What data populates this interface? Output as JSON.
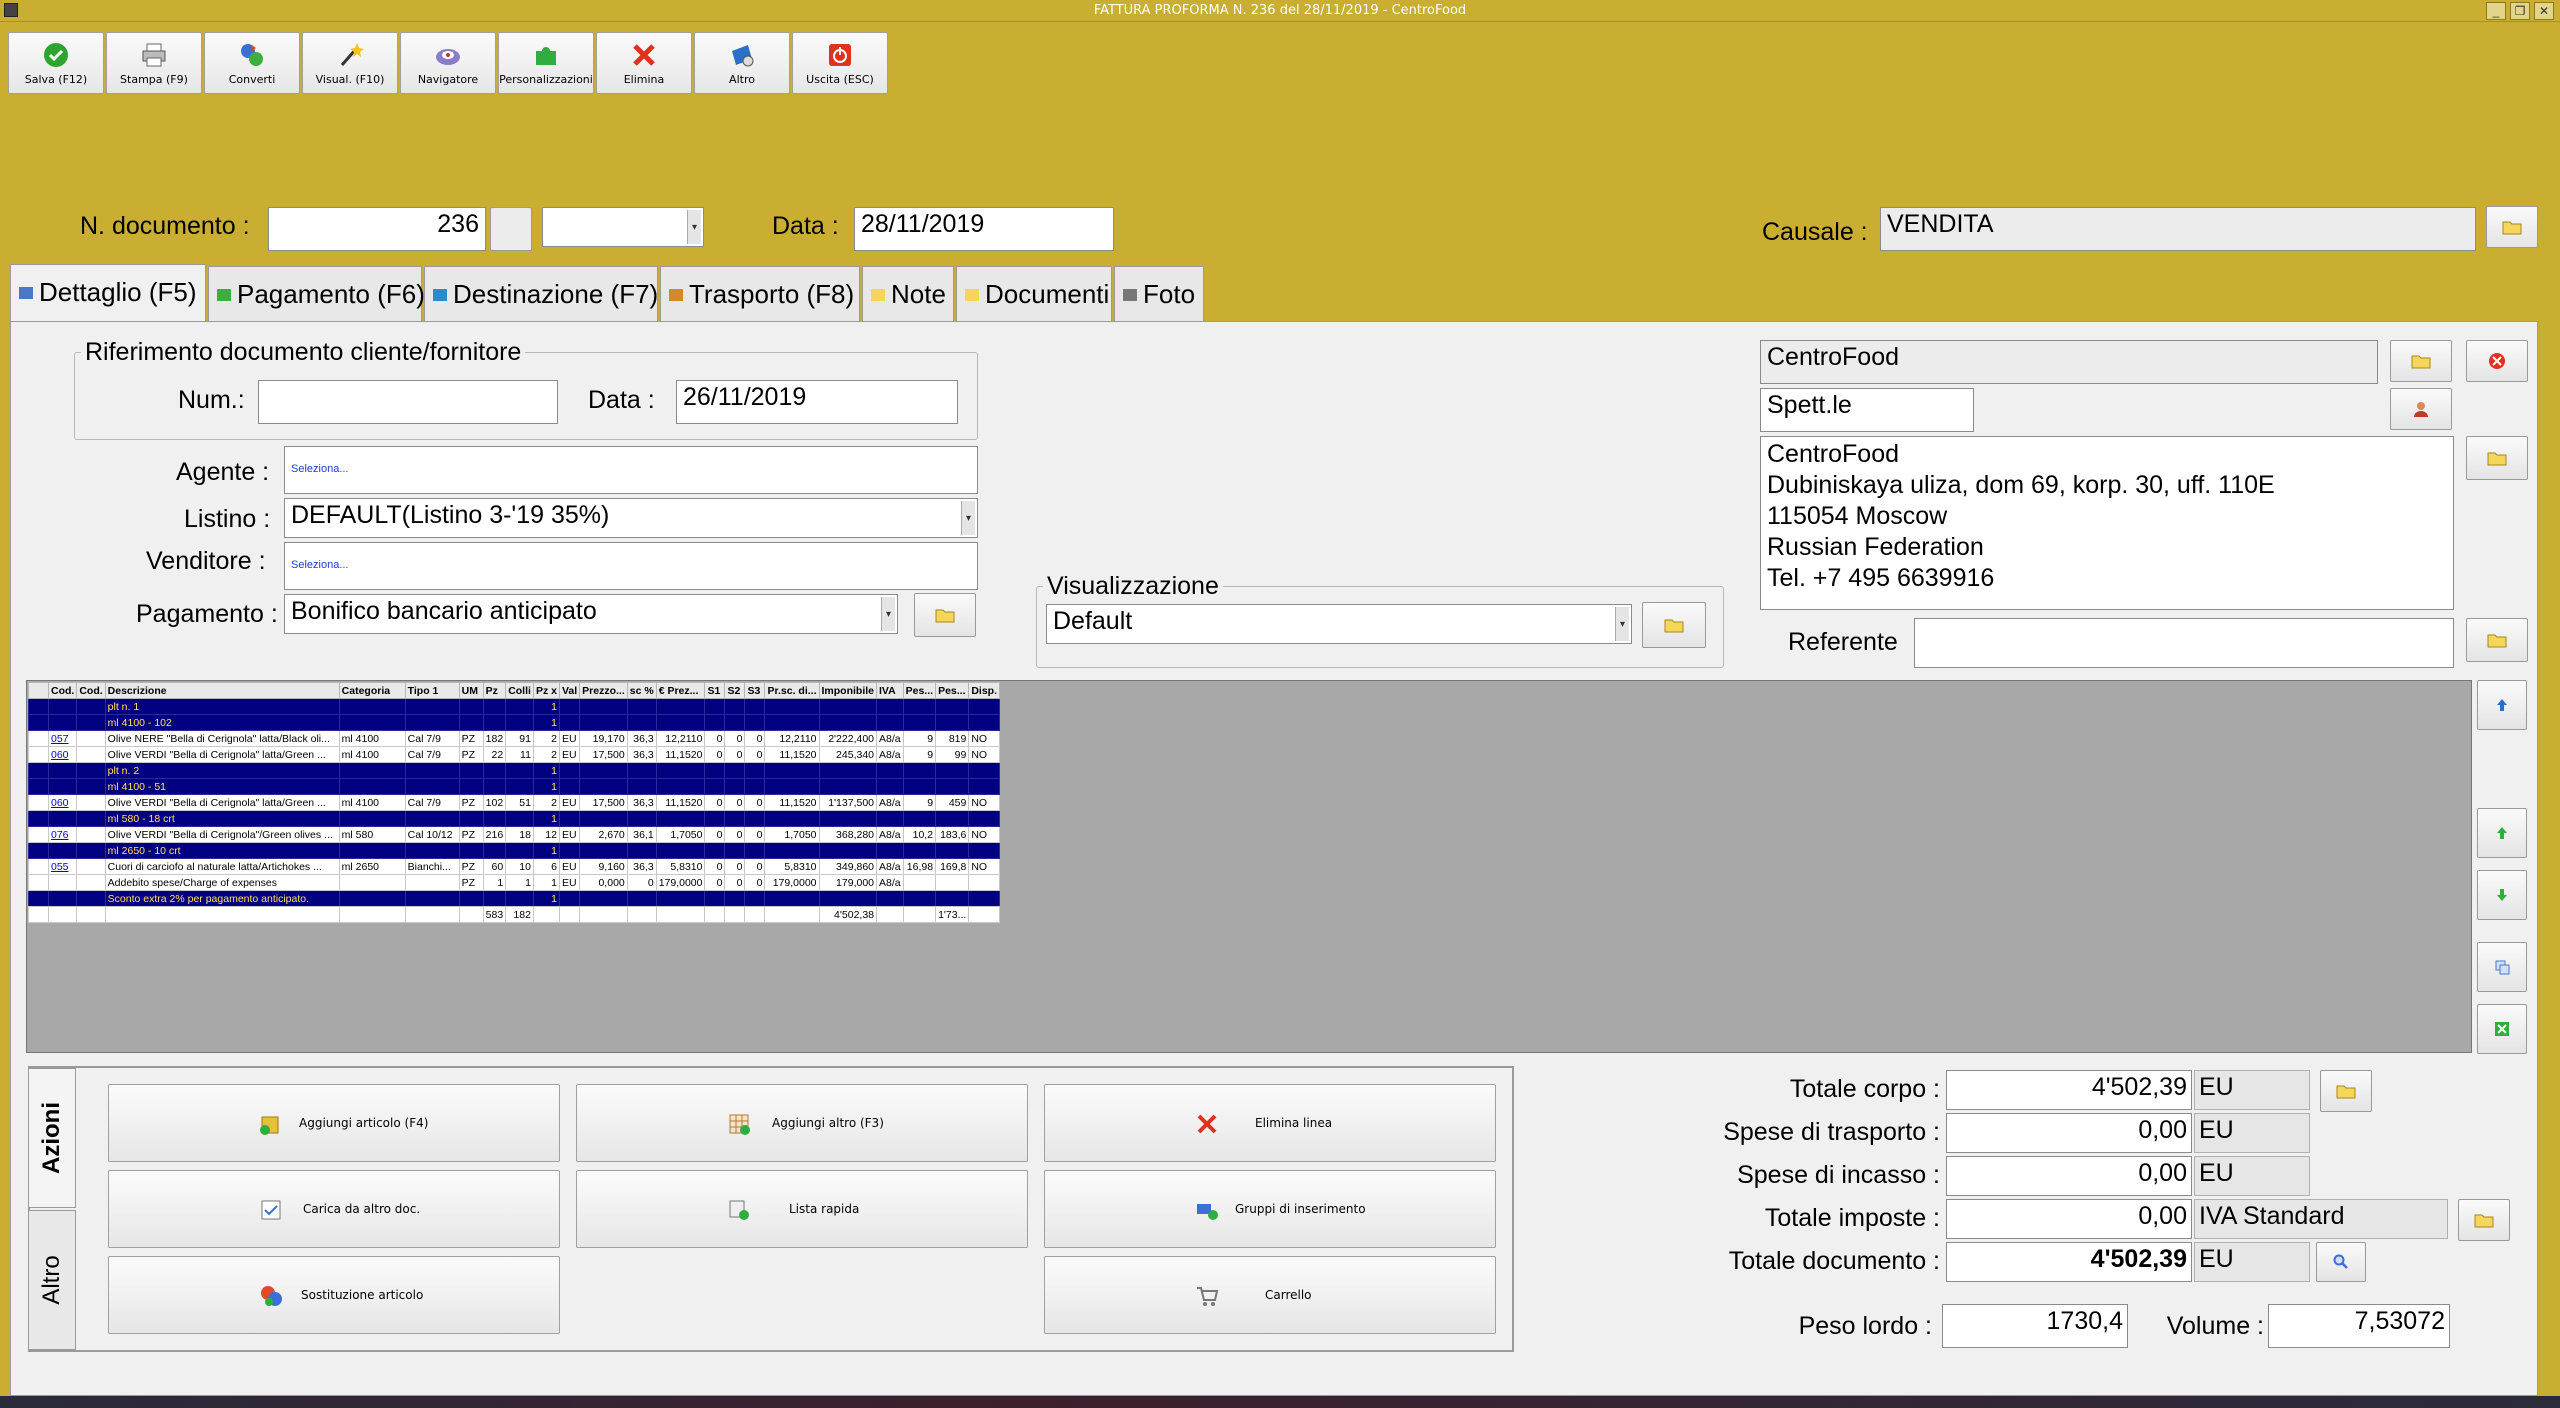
{
  "window": {
    "title": "FATTURA PROFORMA N. 236 del 28/11/2019 - CentroFood"
  },
  "toolbar": [
    {
      "label": "Salva (F12)",
      "icon": "check-icon"
    },
    {
      "label": "Stampa (F9)",
      "icon": "printer-icon"
    },
    {
      "label": "Converti",
      "icon": "convert-icon"
    },
    {
      "label": "Visual. (F10)",
      "icon": "magic-wand-icon"
    },
    {
      "label": "Navigatore",
      "icon": "navigator-icon"
    },
    {
      "label": "Personalizzazioni",
      "icon": "puzzle-icon"
    },
    {
      "label": "Elimina",
      "icon": "delete-x-icon"
    },
    {
      "label": "Altro",
      "icon": "more-icon"
    },
    {
      "label": "Uscita (ESC)",
      "icon": "exit-icon"
    }
  ],
  "header": {
    "doc_number_label": "N. documento :",
    "doc_number": "236",
    "date_label": "Data :",
    "date": "28/11/2019",
    "causale_label": "Causale :",
    "causale": "VENDITA"
  },
  "tabs": [
    {
      "label": "Dettaglio (F5)"
    },
    {
      "label": "Pagamento (F6)"
    },
    {
      "label": "Destinazione (F7)"
    },
    {
      "label": "Trasporto (F8)"
    },
    {
      "label": "Note"
    },
    {
      "label": "Documenti"
    },
    {
      "label": "Foto"
    }
  ],
  "ref_group": {
    "legend": "Riferimento documento cliente/fornitore",
    "num_label": "Num.:",
    "num": "",
    "date_label": "Data :",
    "date": "26/11/2019"
  },
  "form": {
    "agente_label": "Agente :",
    "agente": "Seleziona...",
    "listino_label": "Listino :",
    "listino": "DEFAULT(Listino 3-'19 35%)",
    "venditore_label": "Venditore :",
    "venditore": "Seleziona...",
    "pagamento_label": "Pagamento :",
    "pagamento": "Bonifico bancario anticipato",
    "visualizzazione_legend": "Visualizzazione",
    "visualizzazione": "Default"
  },
  "customer": {
    "name": "CentroFood",
    "salutation": "Spett.le",
    "address_lines": [
      "CentroFood",
      "Dubiniskaya uliza, dom 69, korp. 30, uff. 110E",
      "115054 Moscow",
      "Russian Federation",
      "Tel. +7 495 6639916"
    ],
    "referente_label": "Referente",
    "referente": ""
  },
  "grid": {
    "columns": [
      "",
      "Cod.",
      "Cod.",
      "Descrizione",
      "Categoria",
      "Tipo 1",
      "UM",
      "Pz",
      "Colli",
      "Pz x",
      "Val",
      "Prezzo...",
      "sc %",
      "€ Prez...",
      "S1",
      "S2",
      "S3",
      "Pr.sc. di...",
      "Imponibile",
      "IVA",
      "Pes...",
      "Pes...",
      "Disp."
    ],
    "rows": [
      {
        "type": "sep",
        "cells": [
          "",
          "",
          "",
          "plt n. 1",
          "",
          "",
          "",
          "",
          "",
          "1",
          "",
          "",
          "",
          "",
          "",
          "",
          "",
          "",
          "",
          "",
          "",
          "",
          ""
        ]
      },
      {
        "type": "sep",
        "cells": [
          "",
          "",
          "",
          "ml 4100 - 102",
          "",
          "",
          "",
          "",
          "",
          "1",
          "",
          "",
          "",
          "",
          "",
          "",
          "",
          "",
          "",
          "",
          "",
          "",
          ""
        ]
      },
      {
        "type": "item",
        "cells": [
          "",
          "057",
          "",
          "Olive NERE \"Bella di Cerignola\" latta/Black oli...",
          "ml 4100",
          "Cal 7/9",
          "PZ",
          "182",
          "91",
          "2",
          "EU",
          "19,170",
          "36,3",
          "12,2110",
          "0",
          "0",
          "0",
          "12,2110",
          "2'222,400",
          "A8/a",
          "9",
          "819",
          "NO"
        ]
      },
      {
        "type": "item",
        "cells": [
          "",
          "060",
          "",
          "Olive VERDI \"Bella di Cerignola\" latta/Green ...",
          "ml 4100",
          "Cal 7/9",
          "PZ",
          "22",
          "11",
          "2",
          "EU",
          "17,500",
          "36,3",
          "11,1520",
          "0",
          "0",
          "0",
          "11,1520",
          "245,340",
          "A8/a",
          "9",
          "99",
          "NO"
        ]
      },
      {
        "type": "sep",
        "cells": [
          "",
          "",
          "",
          "plt n. 2",
          "",
          "",
          "",
          "",
          "",
          "1",
          "",
          "",
          "",
          "",
          "",
          "",
          "",
          "",
          "",
          "",
          "",
          "",
          ""
        ]
      },
      {
        "type": "sep",
        "cells": [
          "",
          "",
          "",
          "ml 4100 - 51",
          "",
          "",
          "",
          "",
          "",
          "1",
          "",
          "",
          "",
          "",
          "",
          "",
          "",
          "",
          "",
          "",
          "",
          "",
          ""
        ]
      },
      {
        "type": "item",
        "cells": [
          "",
          "060",
          "",
          "Olive VERDI \"Bella di Cerignola\" latta/Green ...",
          "ml 4100",
          "Cal 7/9",
          "PZ",
          "102",
          "51",
          "2",
          "EU",
          "17,500",
          "36,3",
          "11,1520",
          "0",
          "0",
          "0",
          "11,1520",
          "1'137,500",
          "A8/a",
          "9",
          "459",
          "NO"
        ]
      },
      {
        "type": "sep",
        "cells": [
          "",
          "",
          "",
          "ml 580 - 18 crt",
          "",
          "",
          "",
          "",
          "",
          "1",
          "",
          "",
          "",
          "",
          "",
          "",
          "",
          "",
          "",
          "",
          "",
          "",
          ""
        ]
      },
      {
        "type": "item",
        "cells": [
          "",
          "076",
          "",
          "Olive VERDI \"Bella di Cerignola\"/Green olives ...",
          "ml 580",
          "Cal 10/12",
          "PZ",
          "216",
          "18",
          "12",
          "EU",
          "2,670",
          "36,1",
          "1,7050",
          "0",
          "0",
          "0",
          "1,7050",
          "368,280",
          "A8/a",
          "10,2",
          "183,6",
          "NO"
        ]
      },
      {
        "type": "sep",
        "cells": [
          "",
          "",
          "",
          "ml 2650 - 10 crt",
          "",
          "",
          "",
          "",
          "",
          "1",
          "",
          "",
          "",
          "",
          "",
          "",
          "",
          "",
          "",
          "",
          "",
          "",
          ""
        ]
      },
      {
        "type": "item",
        "cells": [
          "",
          "055",
          "",
          "Cuori di carciofo al naturale latta/Artichokes ...",
          "ml 2650",
          "Bianchi...",
          "PZ",
          "60",
          "10",
          "6",
          "EU",
          "9,160",
          "36,3",
          "5,8310",
          "0",
          "0",
          "0",
          "5,8310",
          "349,860",
          "A8/a",
          "16,98",
          "169,8",
          "NO"
        ]
      },
      {
        "type": "item",
        "cells": [
          "",
          "",
          "",
          "Addebito spese/Charge of expenses",
          "",
          "",
          "PZ",
          "1",
          "1",
          "1",
          "EU",
          "0,000",
          "0",
          "179,0000",
          "0",
          "0",
          "0",
          "179,0000",
          "179,000",
          "A8/a",
          "",
          "",
          ""
        ]
      },
      {
        "type": "sep",
        "cells": [
          "",
          "",
          "",
          "Sconto extra 2% per pagamento anticipato.",
          "",
          "",
          "",
          "",
          "",
          "1",
          "",
          "",
          "",
          "",
          "",
          "",
          "",
          "",
          "",
          "",
          "",
          "",
          ""
        ]
      },
      {
        "type": "tot",
        "cells": [
          "",
          "",
          "",
          "",
          "",
          "",
          "",
          "583",
          "182",
          "",
          "",
          "",
          "",
          "",
          "",
          "",
          "",
          "",
          "4'502,38",
          "",
          "",
          "1'73...",
          ""
        ]
      }
    ]
  },
  "actions": {
    "tab_active": "Azioni",
    "tab_other": "Altro",
    "buttons": [
      {
        "label": "Aggiungi articolo (F4)",
        "icon": "box-add-icon"
      },
      {
        "label": "Aggiungi altro (F3)",
        "icon": "grid-add-icon"
      },
      {
        "label": "Elimina linea",
        "icon": "delete-x-icon"
      },
      {
        "label": "Carica da altro doc.",
        "icon": "load-doc-icon"
      },
      {
        "label": "Lista rapida",
        "icon": "quick-list-icon"
      },
      {
        "label": "Gruppi di inserimento",
        "icon": "groups-icon"
      },
      {
        "label": "Sostituzione articolo",
        "icon": "replace-icon"
      },
      {
        "label": "Carrello",
        "icon": "cart-icon"
      }
    ]
  },
  "totals": {
    "corpo_label": "Totale corpo :",
    "corpo": "4'502,39",
    "trasporto_label": "Spese di trasporto :",
    "trasporto": "0,00",
    "incasso_label": "Spese di incasso :",
    "incasso": "0,00",
    "imposte_label": "Totale imposte :",
    "imposte": "0,00",
    "imposte_unit": "IVA Standard",
    "documento_label": "Totale documento :",
    "documento": "4'502,39",
    "currency": "EU",
    "peso_label": "Peso lordo :",
    "peso": "1730,4",
    "volume_label": "Volume :",
    "volume": "7,53072"
  },
  "colors": {
    "background": "#c9ae32",
    "panel": "#f0f0f0",
    "grid_separator_bg": "#000080",
    "grid_separator_text": "#ffe44d"
  }
}
